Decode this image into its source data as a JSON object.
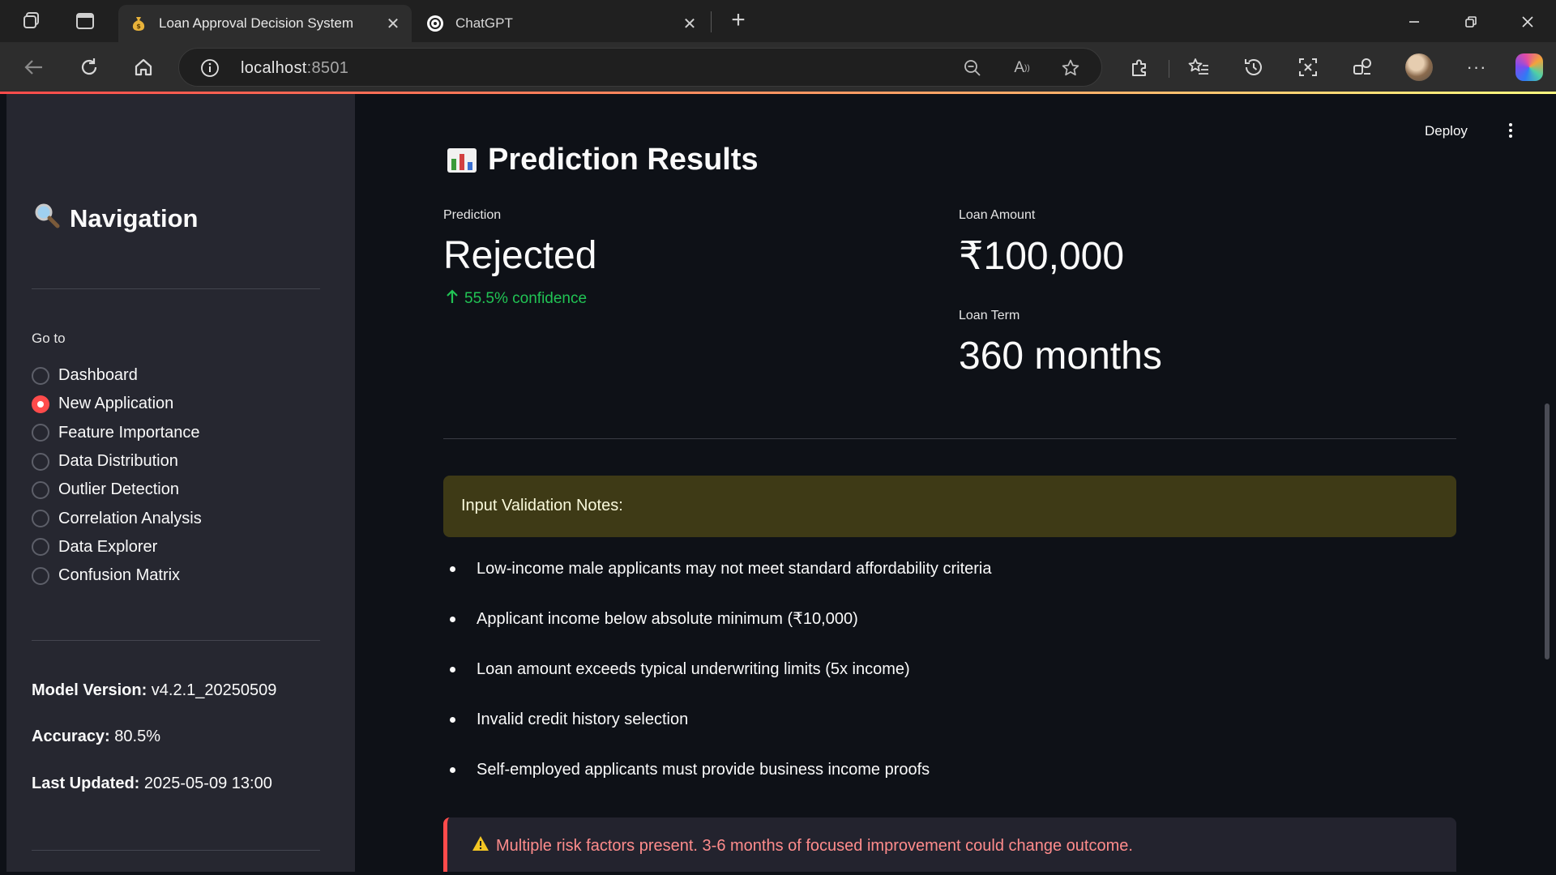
{
  "browser": {
    "tabs": [
      {
        "title": "Loan Approval Decision System",
        "favicon": "money-bag-icon",
        "active": true
      },
      {
        "title": "ChatGPT",
        "favicon": "chatgpt-logo-icon",
        "active": false
      }
    ],
    "url_host": "localhost",
    "url_port": ":8501"
  },
  "sidebar": {
    "title": "Navigation",
    "title_icon": "magnifier-icon",
    "goto_label": "Go to",
    "nav_items": [
      {
        "label": "Dashboard",
        "selected": false
      },
      {
        "label": "New Application",
        "selected": true
      },
      {
        "label": "Feature Importance",
        "selected": false
      },
      {
        "label": "Data Distribution",
        "selected": false
      },
      {
        "label": "Outlier Detection",
        "selected": false
      },
      {
        "label": "Correlation Analysis",
        "selected": false
      },
      {
        "label": "Data Explorer",
        "selected": false
      },
      {
        "label": "Confusion Matrix",
        "selected": false
      }
    ],
    "model_version_label": "Model Version:",
    "model_version_value": " v4.2.1_20250509",
    "accuracy_label": "Accuracy:",
    "accuracy_value": " 80.5%",
    "last_updated_label": "Last Updated:",
    "last_updated_value": " 2025-05-09 13:00"
  },
  "header": {
    "deploy_label": "Deploy"
  },
  "results": {
    "title": "Prediction Results",
    "title_icon": "bar-chart-icon",
    "prediction_label": "Prediction",
    "prediction_value": "Rejected",
    "confidence_delta": "55.5% confidence",
    "loan_amount_label": "Loan Amount",
    "loan_amount_value": "₹100,000",
    "loan_term_label": "Loan Term",
    "loan_term_value": "360 months"
  },
  "validation": {
    "heading": "Input Validation Notes:",
    "notes": [
      "Low-income male applicants may not meet standard affordability criteria",
      "Applicant income below absolute minimum (₹10,000)",
      "Loan amount exceeds typical underwriting limits (5x income)",
      "Invalid credit history selection",
      "Self-employed applicants must provide business income proofs"
    ]
  },
  "risk_alert": {
    "icon": "warning-icon",
    "text": "Multiple risk factors present. 3-6 months of focused improvement could change outcome."
  },
  "colors": {
    "accent": "#ff4b4b",
    "positive": "#21c354",
    "warning_bg": "#3e3a16",
    "sidebar_bg": "#262730",
    "main_bg": "#0e1117"
  }
}
